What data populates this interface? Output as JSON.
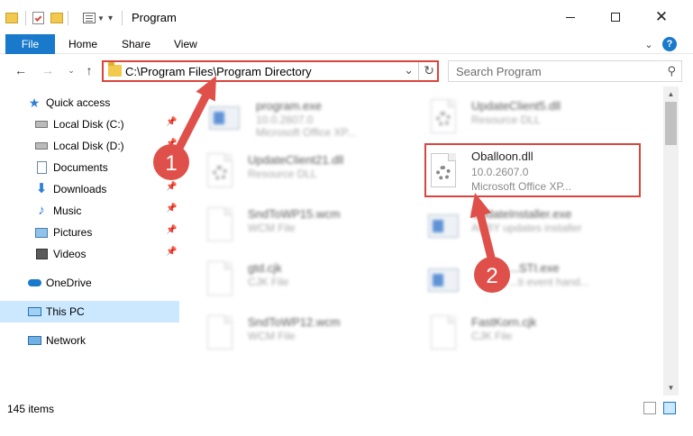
{
  "window": {
    "title": "Program",
    "minimize_icon": "minimize-icon",
    "maximize_icon": "maximize-icon",
    "close_icon": "close-icon"
  },
  "ribbon": {
    "tabs": [
      {
        "label": "File"
      },
      {
        "label": "Home"
      },
      {
        "label": "Share"
      },
      {
        "label": "View"
      }
    ]
  },
  "address": {
    "path": "C:\\Program Files\\Program Directory"
  },
  "search": {
    "placeholder": "Search Program"
  },
  "navpane": {
    "items": [
      {
        "label": "Quick access",
        "icon": "star-icon"
      },
      {
        "label": "Local Disk (C:)",
        "icon": "drive-icon"
      },
      {
        "label": "Local Disk (D:)",
        "icon": "drive-icon"
      },
      {
        "label": "Documents",
        "icon": "documents-icon"
      },
      {
        "label": "Downloads",
        "icon": "download-icon"
      },
      {
        "label": "Music",
        "icon": "music-icon"
      },
      {
        "label": "Pictures",
        "icon": "pictures-icon"
      },
      {
        "label": "Videos",
        "icon": "videos-icon"
      },
      {
        "label": "OneDrive",
        "icon": "cloud-icon"
      },
      {
        "label": "This PC",
        "icon": "computer-icon"
      },
      {
        "label": "Network",
        "icon": "network-icon"
      }
    ]
  },
  "files": [
    {
      "name": "program.exe",
      "line2": "10.0.2607.0",
      "line3": "Microsoft Office XP..."
    },
    {
      "name": "UpdateClient5.dll",
      "line2": "Resource DLL"
    },
    {
      "name": "UpdateClient21.dll",
      "line2": "Resource DLL"
    },
    {
      "name": "Oballoon.dll",
      "line2": "10.0.2607.0",
      "line3": "Microsoft Office XP..."
    },
    {
      "name": "SndToWP15.wcm",
      "line2": "WCM File"
    },
    {
      "name": "UpdateInstaller.exe",
      "line2": "ABBY updates installer"
    },
    {
      "name": "gtd.cjk",
      "line2": "CJK File"
    },
    {
      "name": "...STI.exe",
      "line2": "...ti event hand..."
    },
    {
      "name": "SndToWP12.wcm",
      "line2": "WCM File"
    },
    {
      "name": "FastKorn.cjk",
      "line2": "CJK File"
    }
  ],
  "status": {
    "item_count": "145 items"
  },
  "annotations": {
    "step1": "1",
    "step2": "2",
    "color": "#e0504a",
    "box_color": "#d9453c"
  },
  "colors": {
    "accent": "#1979ca",
    "selection": "#cce8ff",
    "folder": "#f2c94c"
  }
}
